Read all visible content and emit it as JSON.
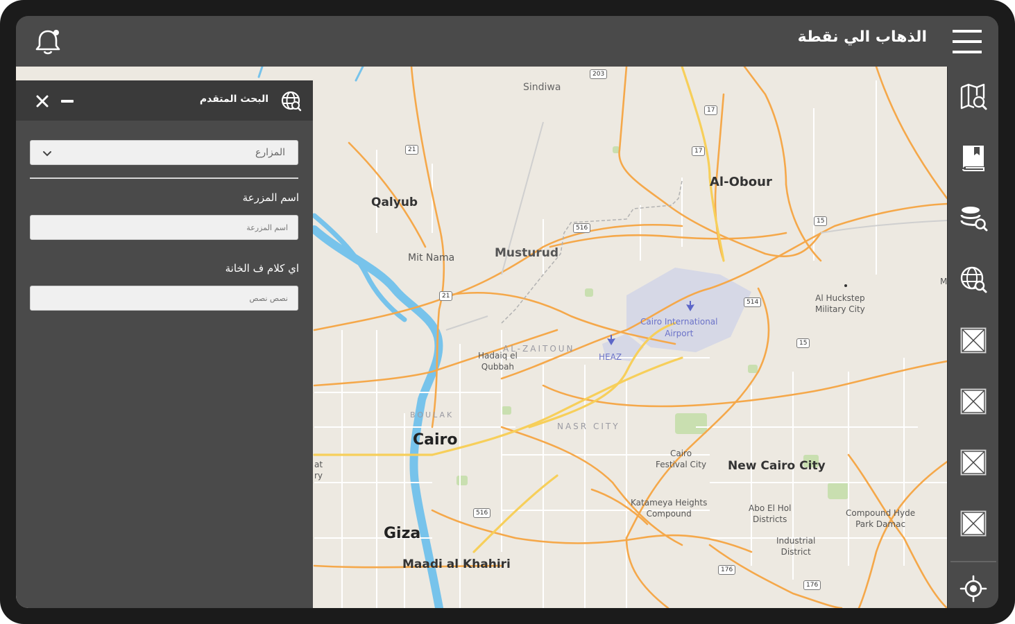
{
  "header": {
    "title": "الذهاب الي نقطة"
  },
  "search_panel": {
    "title": "البحث المتقدم",
    "category_select": {
      "value": "المزارع"
    },
    "fields": [
      {
        "label": "اسم المزرعة",
        "placeholder": "اسم المزرعة"
      },
      {
        "label": "اي كلام ف الخانة",
        "placeholder": "نصص نصص"
      }
    ]
  },
  "sidebar": {
    "buttons": [
      "map-search-icon",
      "bookmark-book-icon",
      "layers-search-icon",
      "globe-search-icon",
      "placeholder-icon",
      "placeholder-icon",
      "placeholder-icon",
      "placeholder-icon",
      "locate-crosshair-icon"
    ]
  },
  "map": {
    "labels": {
      "sindiwa": "Sindiwa",
      "al_obour": "Al-Obour",
      "qalyub": "Qalyub",
      "musturud": "Musturud",
      "mit_nama": "Mit Nama",
      "al_zaitoun": "AL-ZAITOUN",
      "airport_line1": "Cairo International",
      "airport_line2": "Airport",
      "heaz": "HEAZ",
      "hadaiq_line1": "Hadaiq el",
      "hadaiq_line2": "Qubbah",
      "al_huckstep_line1": "Al Huckstep",
      "al_huckstep_line2": "Military City",
      "boulak": "BOULAK",
      "cairo": "Cairo",
      "nasr_city": "NASR CITY",
      "festival_line1": "Cairo",
      "festival_line2": "Festival City",
      "new_cairo": "New Cairo City",
      "giza": "Giza",
      "maadi": "Maadi al Khahiri",
      "katameya_line1": "Katameya Heights",
      "katameya_line2": "Compound",
      "abu_el_hol_line1": "Abo El Hol",
      "abu_el_hol_line2": "Districts",
      "industrial_line1": "Industrial",
      "industrial_line2": "District",
      "hyde_park_line1": "Compound Hyde",
      "hyde_park_line2": "Park Damac",
      "edge_left_1": "at",
      "edge_left_2": "ry",
      "edge_right": "M"
    },
    "route_shields": {
      "r203": "203",
      "r17a": "17",
      "r21a": "21",
      "r17b": "17",
      "r516a": "516",
      "r15a": "15",
      "r21b": "21",
      "r514": "514",
      "r15b": "15",
      "r516b": "516",
      "r176a": "176",
      "r176b": "176"
    }
  }
}
